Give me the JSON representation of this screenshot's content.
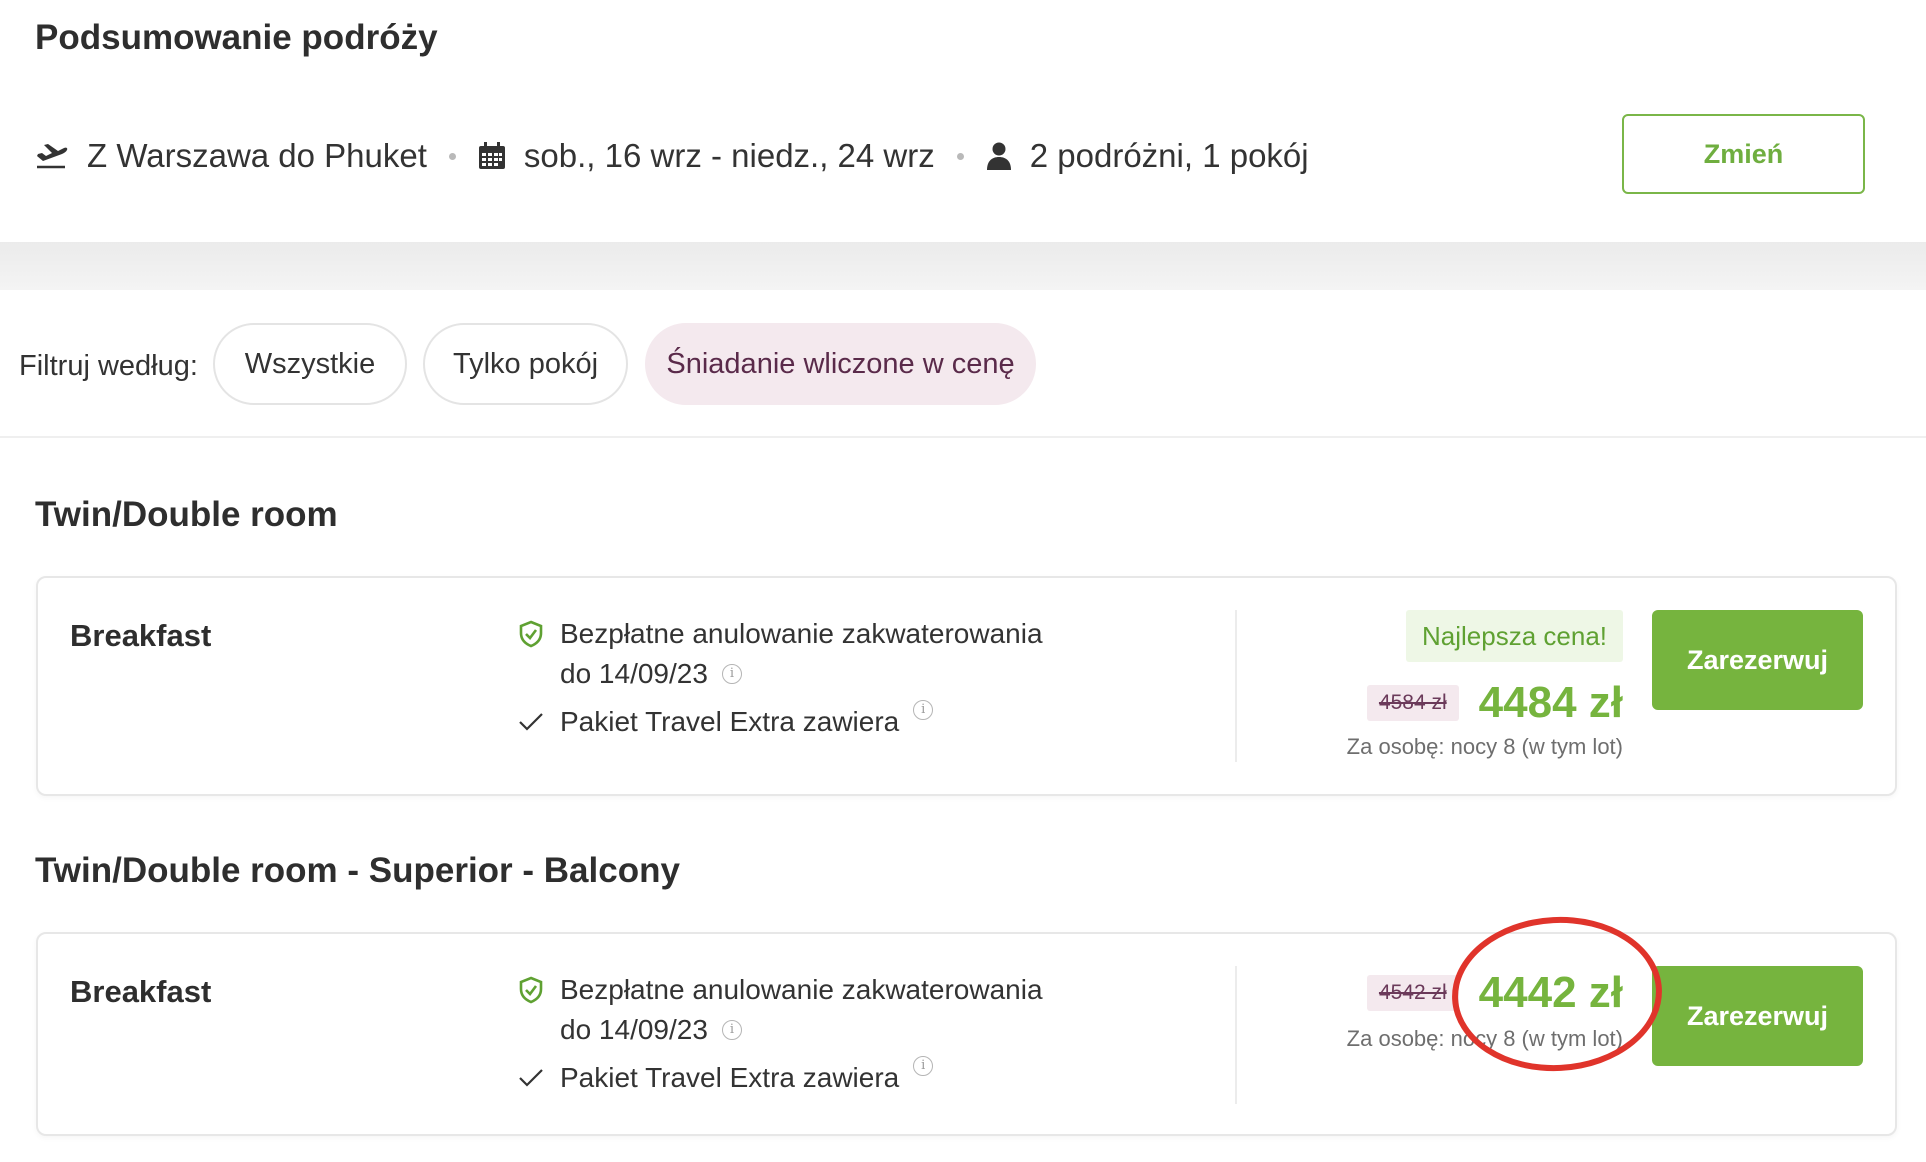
{
  "summary": {
    "title": "Podsumowanie podróży",
    "route": "Z Warszawa do Phuket",
    "dates": "sob., 16 wrz - niedz., 24 wrz",
    "travellers": "2 podróżni, 1 pokój",
    "change_label": "Zmień"
  },
  "filters": {
    "label": "Filtruj według:",
    "options": [
      {
        "label": "Wszystkie",
        "active": false
      },
      {
        "label": "Tylko pokój",
        "active": false
      },
      {
        "label": "Śniadanie wliczone w cenę",
        "active": true
      }
    ]
  },
  "rooms": [
    {
      "title": "Twin/Double room",
      "offer": {
        "board": "Breakfast",
        "cancellation_line1": "Bezpłatne anulowanie zakwaterowania",
        "cancellation_line2": "do 14/09/23",
        "package": "Pakiet Travel Extra zawiera",
        "badge": "Najlepsza cena!",
        "old_price": "4584 zł",
        "price": "4484 zł",
        "per_person": "Za osobę: nocy 8 (w tym lot)",
        "book_label": "Zarezerwuj"
      }
    },
    {
      "title": "Twin/Double room - Superior - Balcony",
      "offer": {
        "board": "Breakfast",
        "cancellation_line1": "Bezpłatne anulowanie zakwaterowania",
        "cancellation_line2": "do 14/09/23",
        "package": "Pakiet Travel Extra zawiera",
        "old_price": "4542 zł",
        "price": "4442 zł",
        "per_person": "Za osobę: nocy 8 (w tym lot)",
        "book_label": "Zarezerwuj"
      }
    }
  ],
  "icons": {
    "flight": "plane-departure-icon",
    "dates": "calendar-icon",
    "travellers": "person-icon",
    "cancellation": "shield-check-icon",
    "package": "checkmark-icon",
    "info": "info-icon"
  },
  "colors": {
    "accent_green": "#76b43e",
    "filter_active_bg": "#f4e9ee",
    "annotation_red": "#e0342b"
  }
}
